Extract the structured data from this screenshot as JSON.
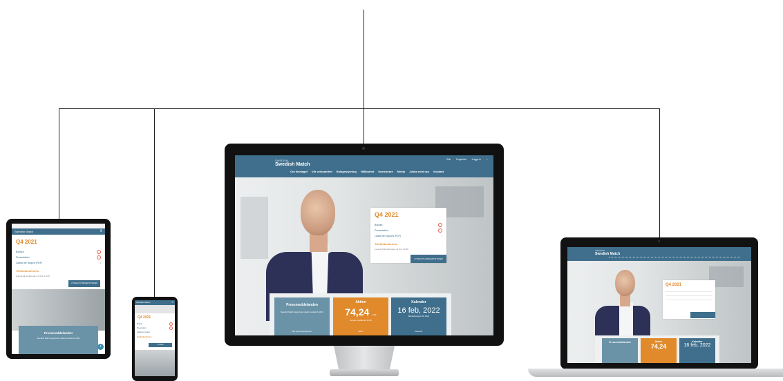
{
  "brand": {
    "logo_small": "SWEDISH",
    "logo_main": "Swedish Match",
    "color_primary": "#3f6f8c",
    "color_accent": "#e08a2c"
  },
  "desktop": {
    "utility_links": [
      "Sök",
      "Engelska",
      "Logga in"
    ],
    "utility_icons": [
      "search-icon",
      "globe-icon"
    ],
    "nav": [
      "Om företaget",
      "Vår verksamhet",
      "Bolagsstyrning",
      "Hållbarhet",
      "Investerare",
      "Media",
      "Jobba med oss",
      "Kontakt"
    ],
    "report_card": {
      "quarter": "Q4 2021",
      "rows": [
        "Bokslut",
        "Presentation",
        "Ladda ner rapport (PDF)"
      ],
      "conference_label": "Telefonkonferens",
      "conference_text": "Lyssna till konferensen 11 feb, 13:00",
      "button": "LYSSNA PÅ PRESENTATIONEN"
    },
    "tiles": [
      {
        "title": "Pressmeddelanden",
        "text": "Swedish Match rapporterar starkt resultat för 2021",
        "link": "Alla pressmeddelanden"
      },
      {
        "title": "Aktien",
        "value": "74,24",
        "unit": "SEK",
        "sub": "Senast uppdaterad 16:00",
        "link": "Aktien"
      },
      {
        "title": "Kalender",
        "value": "16 feb, 2022",
        "sub": "Bokslutsrapport för 2021",
        "link": "Kalender"
      }
    ]
  },
  "laptop": {
    "quarter": "Q4 2021",
    "tiles": [
      {
        "title": "Pressmeddelanden"
      },
      {
        "title": "Aktien",
        "value": "74,24"
      },
      {
        "title": "Kalender",
        "value": "16 feb, 2022"
      }
    ]
  },
  "tablet": {
    "header": "Swedish Match",
    "quarter": "Q4 2021",
    "rows": [
      "Bokslut",
      "Presentation",
      "Ladda ner rapport (PDF)"
    ],
    "conference_label": "Telefonkonferens",
    "conference_text": "Lyssna till konferensen 11 feb, 13:00",
    "button": "LYSSNA PÅ PRESENTATIONEN",
    "tile_title": "Pressmeddelanden",
    "tile_text": "Swedish Match rapporterar starkt resultat för 2021"
  },
  "phone": {
    "header": "Swedish Match",
    "quarter": "Q4 2021",
    "rows": [
      "Bokslut",
      "Presentation",
      "Ladda ner rapport"
    ],
    "conference_label": "Telefonkonferens",
    "button": "LYSSNA"
  }
}
